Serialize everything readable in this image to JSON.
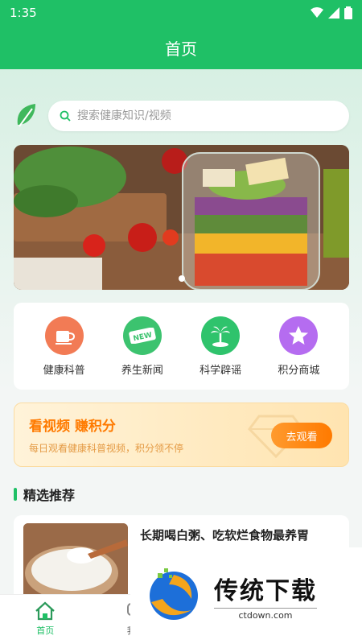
{
  "status_bar": {
    "time": "1:35"
  },
  "header": {
    "title": "首页"
  },
  "search": {
    "placeholder": "搜索健康知识/视频"
  },
  "menu": {
    "items": [
      {
        "label": "健康科普",
        "icon": "cup-icon",
        "color": "#f27b55"
      },
      {
        "label": "养生新闻",
        "icon": "new-badge-icon",
        "color": "#3cc36f"
      },
      {
        "label": "科学辟谣",
        "icon": "palm-island-icon",
        "color": "#2fc36c"
      },
      {
        "label": "积分商城",
        "icon": "star-icon",
        "color": "#b56cf0"
      }
    ]
  },
  "promo": {
    "title": "看视频 赚积分",
    "subtitle": "每日观看健康科普视频，积分领不停",
    "button": "去观看"
  },
  "section": {
    "title": "精选推荐"
  },
  "articles": [
    {
      "title": "长期喝白粥、吃软烂食物最养胃"
    }
  ],
  "tabs": [
    {
      "label": "首页",
      "icon": "home-icon",
      "active": true
    },
    {
      "label": "我的",
      "icon": "chat-icon",
      "active": false
    }
  ],
  "watermark": {
    "title": "传统下载",
    "url": "ctdown.com"
  },
  "colors": {
    "primary": "#1fc066",
    "accent": "#ff7a00"
  }
}
